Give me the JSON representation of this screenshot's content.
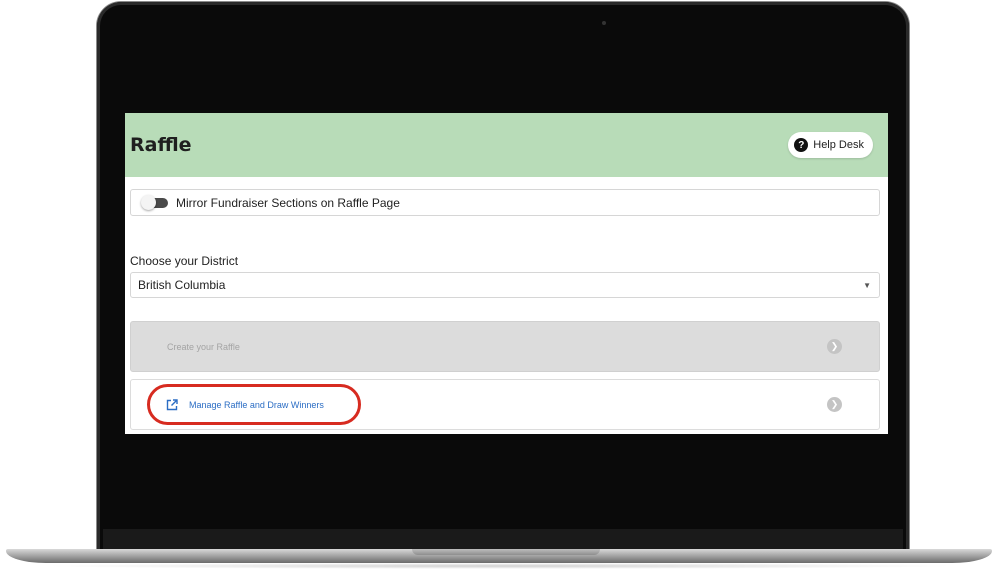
{
  "app": {
    "title": "Raffle",
    "help_label": "Help Desk"
  },
  "mirror_toggle": {
    "label": "Mirror Fundraiser Sections on Raffle Page",
    "state": "off"
  },
  "district": {
    "label": "Choose your District",
    "selected": "British Columbia"
  },
  "actions": {
    "create_label": "Create your Raffle",
    "manage_label": "Manage Raffle and Draw Winners"
  },
  "icons": {
    "help": "question-circle-icon",
    "external": "external-link-icon",
    "arrow": "chevron-right-circle-icon",
    "caret": "chevron-down-icon"
  },
  "colors": {
    "header_bg": "#b8dcb8",
    "link_blue": "#2b6dc4",
    "highlight_red": "#d72b20",
    "disabled_row_bg": "#dcdcdc"
  }
}
